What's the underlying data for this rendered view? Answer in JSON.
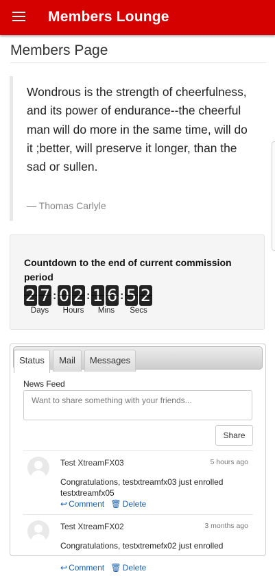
{
  "appbar": {
    "title": "Members Lounge",
    "menu_icon": "hamburger-menu-icon"
  },
  "page": {
    "title": "Members Page"
  },
  "quote": {
    "text": "Wondrous is the strength of cheerfulness, and its power of endurance--the cheerful man will do more in the same time, will do it ;better, will preserve it longer, than the sad or sullen.",
    "author": "— Thomas Carlyle"
  },
  "countdown": {
    "heading": "Countdown to the end of current commission period",
    "days": [
      "2",
      "7"
    ],
    "hours": [
      "0",
      "2"
    ],
    "mins": [
      "1",
      "6"
    ],
    "secs": [
      "5",
      "2"
    ],
    "separator": ":",
    "labels": {
      "days": "Days",
      "hours": "Hours",
      "mins": "Mins",
      "secs": "Secs"
    }
  },
  "tabs": [
    {
      "label": "Status",
      "active": true
    },
    {
      "label": "Mail",
      "active": false
    },
    {
      "label": "Messages",
      "active": false
    }
  ],
  "feed": {
    "label": "News Feed",
    "placeholder": "Want to share something with your friends...",
    "share_label": "Share",
    "posts": [
      {
        "author": "Test XtreamFX03",
        "time": "5 hours ago",
        "body": "Congratulations, testxtreamfx03 just enrolled testxtreamfx05",
        "comment_label": "Comment",
        "delete_label": "Delete"
      },
      {
        "author": "Test XtreamFX02",
        "time": "3 months ago",
        "body": "Congratulations, testxtremefx02 just enrolled",
        "comment_label": "Comment",
        "delete_label": "Delete"
      }
    ]
  },
  "colors": {
    "appbar": "#d50000",
    "link": "#1a5fa8",
    "digit_bg": "#222222"
  }
}
